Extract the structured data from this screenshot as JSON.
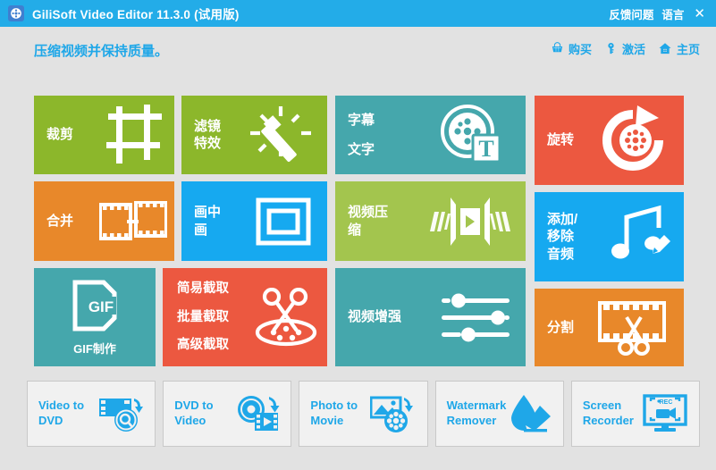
{
  "titlebar": {
    "logo_icon": "film-reel-icon",
    "title": "GiliSoft Video Editor 11.3.0 (试用版)",
    "links": [
      {
        "label": "反馈问题",
        "name": "feedback-link"
      },
      {
        "label": "语言",
        "name": "language-link"
      }
    ],
    "close_label": "✕",
    "bg_color": "#23ace8"
  },
  "subheader": {
    "tagline": "压缩视频并保持质量。",
    "tagline_color": "#1fa7e8",
    "actions": [
      {
        "label": "购买",
        "icon": "cart-icon",
        "name": "buy-action"
      },
      {
        "label": "激活",
        "icon": "key-icon",
        "name": "activate-action"
      },
      {
        "label": "主页",
        "icon": "home-icon",
        "name": "home-action"
      }
    ]
  },
  "tiles": [
    {
      "id": "crop",
      "labels": [
        "裁剪"
      ],
      "color": "#8cb72b",
      "icon": "crop-film-icon",
      "name": "tile-crop"
    },
    {
      "id": "filter",
      "labels": [
        "滤镜",
        "特效"
      ],
      "color": "#8cb72b",
      "icon": "magic-wand-icon",
      "name": "tile-filter-effects"
    },
    {
      "id": "subtitle",
      "labels": [
        "字幕",
        "文字"
      ],
      "color": "#45a7ac",
      "icon": "reel-text-icon",
      "name": "tile-subtitle-text"
    },
    {
      "id": "rotate",
      "labels": [
        "旋转"
      ],
      "color": "#ec5840",
      "icon": "rotate-reel-icon",
      "name": "tile-rotate"
    },
    {
      "id": "merge",
      "labels": [
        "合并"
      ],
      "color": "#e8882a",
      "icon": "merge-film-icon",
      "name": "tile-merge"
    },
    {
      "id": "pip",
      "labels": [
        "画中",
        "画"
      ],
      "color": "#16a9f0",
      "icon": "pip-frame-icon",
      "name": "tile-picture-in-picture"
    },
    {
      "id": "compress",
      "labels": [
        "视频压",
        "缩"
      ],
      "color": "#a3c54e",
      "icon": "compress-video-icon",
      "name": "tile-video-compress"
    },
    {
      "id": "audio",
      "labels": [
        "添加/",
        "移除",
        "音频"
      ],
      "color": "#16a9f0",
      "icon": "music-pencil-icon",
      "name": "tile-add-remove-audio"
    },
    {
      "id": "gif",
      "labels": [],
      "caption": "GIF制作",
      "color": "#45a7ac",
      "icon": "gif-file-icon",
      "name": "tile-gif-maker"
    },
    {
      "id": "capture",
      "labels": [
        "简易截取",
        "批量截取",
        "高级截取"
      ],
      "color": "#ec5840",
      "icon": "scissors-reel-icon",
      "name": "tile-capture"
    },
    {
      "id": "enhance",
      "labels": [
        "视频增强"
      ],
      "color": "#45a7ac",
      "icon": "sliders-icon",
      "name": "tile-video-enhance"
    },
    {
      "id": "split",
      "labels": [
        "分割"
      ],
      "color": "#e8882a",
      "icon": "film-scissors-icon",
      "name": "tile-split"
    }
  ],
  "bottom_cards": [
    {
      "label_lines": [
        "Video to",
        "DVD"
      ],
      "icon": "video-to-dvd-icon",
      "name": "card-video-to-dvd"
    },
    {
      "label_lines": [
        "DVD to",
        "Video"
      ],
      "icon": "dvd-to-video-icon",
      "name": "card-dvd-to-video"
    },
    {
      "label_lines": [
        "Photo to",
        "Movie"
      ],
      "icon": "photo-to-movie-icon",
      "name": "card-photo-to-movie"
    },
    {
      "label_lines": [
        "Watermark",
        "Remover"
      ],
      "icon": "watermark-remover-icon",
      "name": "card-watermark-remover"
    },
    {
      "label_lines": [
        "Screen",
        "Recorder"
      ],
      "icon": "screen-recorder-icon",
      "name": "card-screen-recorder"
    }
  ],
  "theme": {
    "background": "#e2e2e2",
    "accent": "#1fa7e8"
  }
}
